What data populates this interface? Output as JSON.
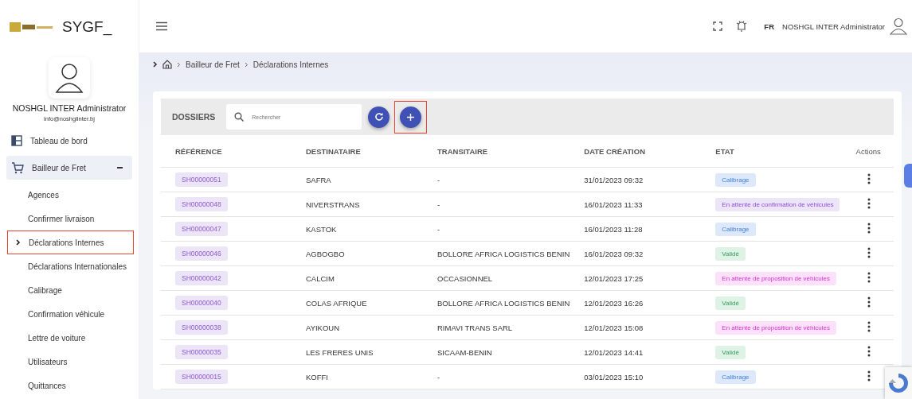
{
  "brand": {
    "title": "SYGF_"
  },
  "profile": {
    "name": "NOSHGL INTER Administrator",
    "email": "info@noshglinter.bj"
  },
  "nav": [
    {
      "label": "Tableau de bord",
      "kind": "top",
      "expanded": false
    },
    {
      "label": "Bailleur de Fret",
      "kind": "top",
      "expanded": true
    },
    {
      "label": "Agences",
      "kind": "sub",
      "selected": false
    },
    {
      "label": "Confirmer livraison",
      "kind": "sub",
      "selected": false
    },
    {
      "label": "Déclarations Internes",
      "kind": "sub",
      "selected": true
    },
    {
      "label": "Déclarations Internationales",
      "kind": "sub",
      "selected": false
    },
    {
      "label": "Calibrage",
      "kind": "sub",
      "selected": false
    },
    {
      "label": "Confirmation véhicule",
      "kind": "sub",
      "selected": false
    },
    {
      "label": "Lettre de voiture",
      "kind": "sub",
      "selected": false
    },
    {
      "label": "Utilisateurs",
      "kind": "sub",
      "selected": false
    },
    {
      "label": "Quittances",
      "kind": "sub",
      "selected": false
    }
  ],
  "topbar": {
    "language": "FR",
    "user": "NOSHGL INTER Administrator"
  },
  "breadcrumb": [
    "Bailleur de Fret",
    "Déclarations Internes"
  ],
  "toolbar": {
    "title": "DOSSIERS",
    "search_placeholder": "Rechercher",
    "add_highlighted": true
  },
  "table": {
    "columns": [
      "RÉFÉRENCE",
      "DESTINATAIRE",
      "TRANSITAIRE",
      "DATE CRÉATION",
      "ETAT",
      "Actions"
    ],
    "rows": [
      {
        "reference": "SH00000051",
        "destinataire": "SAFRA",
        "transitaire": "-",
        "date": "31/01/2023 09:32",
        "etat": "Calibrage",
        "kind": "calibrage"
      },
      {
        "reference": "SH00000048",
        "destinataire": "NIVERSTRANS",
        "transitaire": "-",
        "date": "16/01/2023 11:33",
        "etat": "En attente de confirmation de véhicules",
        "kind": "confirmation"
      },
      {
        "reference": "SH00000047",
        "destinataire": "KASTOK",
        "transitaire": "-",
        "date": "16/01/2023 11:28",
        "etat": "Calibrage",
        "kind": "calibrage"
      },
      {
        "reference": "SH00000046",
        "destinataire": "AGBOGBO",
        "transitaire": "BOLLORE AFRICA LOGISTICS BENIN",
        "date": "16/01/2023 09:32",
        "etat": "Validé",
        "kind": "valide"
      },
      {
        "reference": "SH00000042",
        "destinataire": "CALCIM",
        "transitaire": "OCCASIONNEL",
        "date": "12/01/2023 17:25",
        "etat": "En attente de proposition de véhicules",
        "kind": "proposition"
      },
      {
        "reference": "SH00000040",
        "destinataire": "COLAS AFRIQUE",
        "transitaire": "BOLLORE AFRICA LOGISTICS BENIN",
        "date": "12/01/2023 16:26",
        "etat": "Validé",
        "kind": "valide"
      },
      {
        "reference": "SH00000038",
        "destinataire": "AYIKOUN",
        "transitaire": "RIMAVI TRANS SARL",
        "date": "12/01/2023 15:08",
        "etat": "En attente de proposition de véhicules",
        "kind": "proposition"
      },
      {
        "reference": "SH00000035",
        "destinataire": "LES FRERES UNIS",
        "transitaire": "SICAAM-BENIN",
        "date": "12/01/2023 14:41",
        "etat": "Validé",
        "kind": "valide"
      },
      {
        "reference": "SH00000015",
        "destinataire": "KOFFI",
        "transitaire": "-",
        "date": "03/01/2023 15:10",
        "etat": "Calibrage",
        "kind": "calibrage"
      }
    ]
  }
}
